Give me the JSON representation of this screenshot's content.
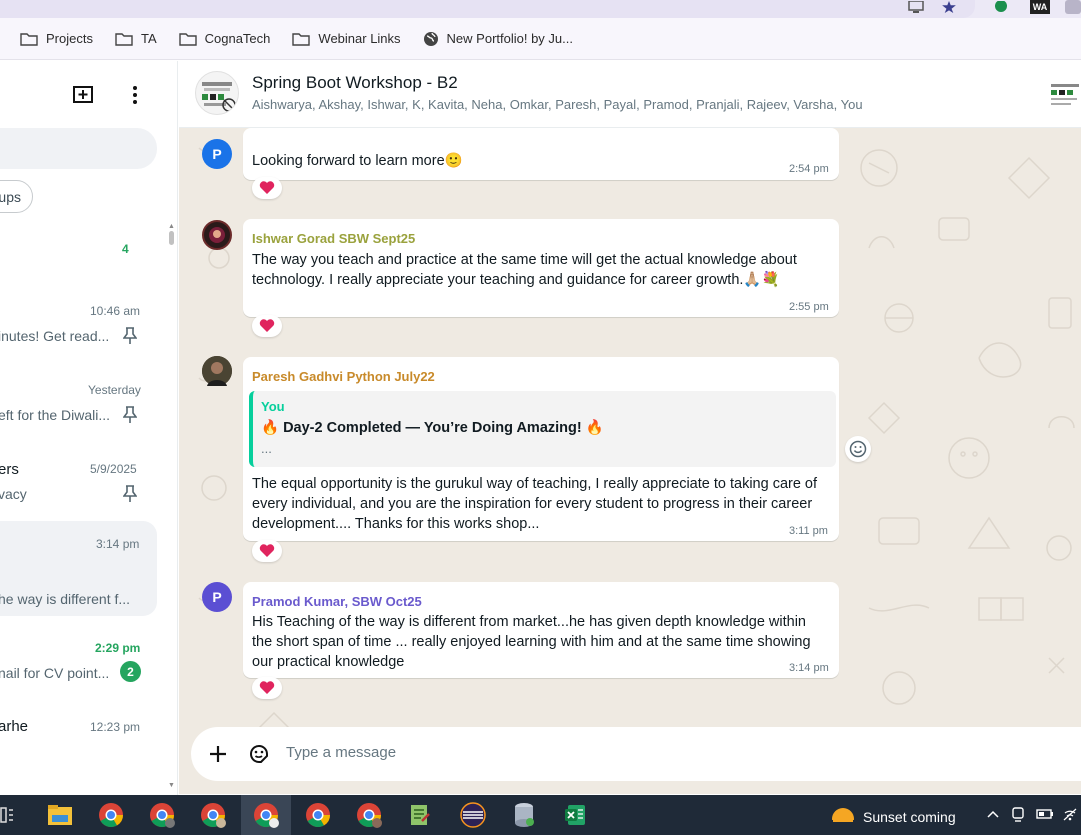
{
  "browser": {
    "bookmarks": [
      {
        "label": "Projects",
        "icon": "folder-icon"
      },
      {
        "label": "TA",
        "icon": "folder-icon"
      },
      {
        "label": "CognaTech",
        "icon": "folder-icon"
      },
      {
        "label": "Webinar Links",
        "icon": "folder-icon"
      },
      {
        "label": "New Portfolio! by Ju...",
        "icon": "globe-icon"
      }
    ],
    "top_right_labels": [
      "WA"
    ]
  },
  "sidebar": {
    "filter_chip": "ups",
    "chats": [
      {
        "unread": "4"
      },
      {
        "time": "10:46 am",
        "preview": "inutes! Get read...",
        "pinned": true
      },
      {
        "time": "Yesterday",
        "preview": "eft for the Diwali...",
        "pinned": true
      },
      {
        "title": "ers",
        "time": "5/9/2025",
        "preview": "vacy",
        "pinned": true
      },
      {
        "time": "3:14 pm",
        "preview": "he way is different f...",
        "active": true
      },
      {
        "time": "2:29 pm",
        "preview": "nail for CV point...",
        "unread": "2"
      },
      {
        "title": "arhe",
        "time": "12:23 pm"
      }
    ]
  },
  "chat": {
    "title": "Spring Boot Workshop - B2",
    "members": "Aishwarya, Akshay, Ishwar, K, Kavita, Neha, Omkar, Paresh, Payal, Pramod, Pranjali, Rajeev, Varsha, You",
    "messages": [
      {
        "avatar_letter": "P",
        "avatar_color": "#1a73e8",
        "text": "Looking forward to learn more",
        "emoji": "🙂",
        "time": "2:54 pm",
        "reaction": "❤️"
      },
      {
        "sender": "Ishwar Gorad SBW Sept25",
        "sender_color": "#9aa23d",
        "text": "The way you teach and practice at the same time will get the actual knowledge about technology. I really appreciate your teaching and guidance for career growth.",
        "emoji": "🙏🏼💐",
        "time": "2:55 pm",
        "reaction": "❤️"
      },
      {
        "sender": "Paresh Gadhvi Python July22",
        "sender_color": "#c88a2a",
        "quote": {
          "author": "You",
          "text": "🔥 Day-2 Completed — You’re Doing Amazing! 🔥",
          "more": "..."
        },
        "text": "The equal opportunity is the gurukul way of teaching, I really appreciate to taking care of every individual, and you are the inspiration for every student to progress in their career development.... Thanks for this works shop...",
        "time": "3:11 pm",
        "reaction": "❤️"
      },
      {
        "avatar_letter": "P",
        "avatar_color": "#5b4fd3",
        "sender": "Pramod Kumar, SBW Oct25",
        "sender_color": "#6a5acd",
        "text": "His Teaching of the way is different from market...he has given depth knowledge within the short span of time ... really enjoyed learning with him and at the same time showing our practical knowledge",
        "time": "3:14 pm",
        "reaction": "❤️"
      }
    ],
    "composer_placeholder": "Type a message"
  },
  "taskbar": {
    "weather": "Sunset coming"
  }
}
